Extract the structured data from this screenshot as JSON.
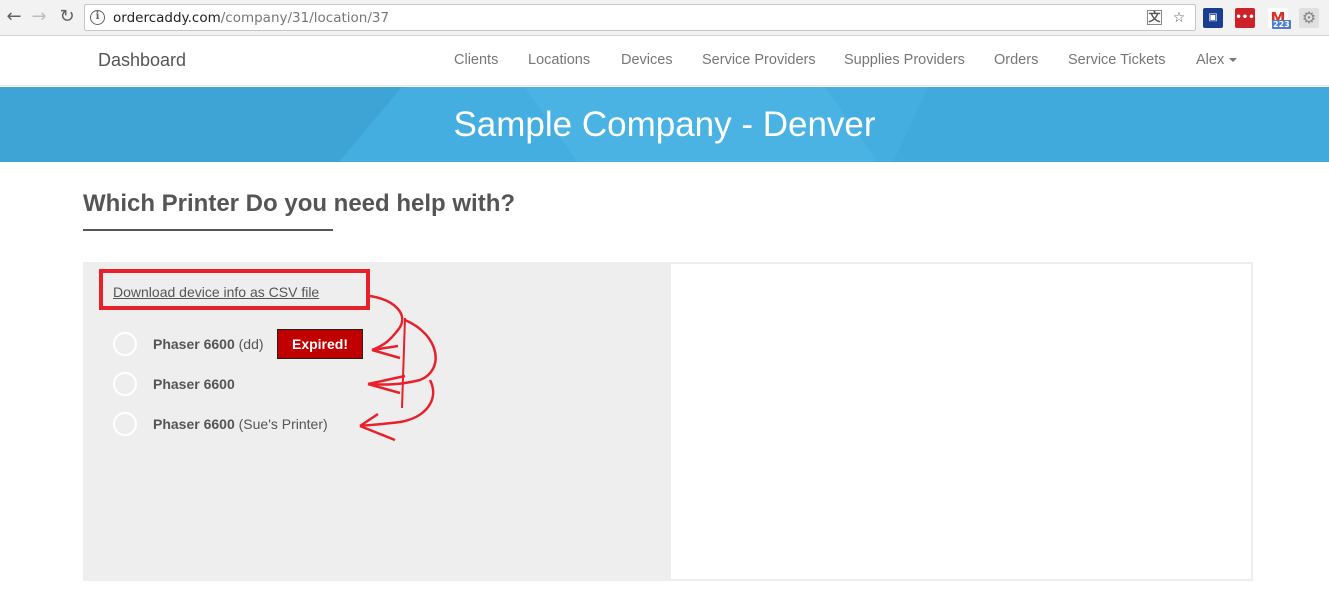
{
  "browser": {
    "url_host": "ordercaddy.com",
    "url_path": "/company/31/location/37",
    "extensions": [
      {
        "name": "translate-icon"
      },
      {
        "name": "bookmark-star-icon"
      },
      {
        "name": "extension-icon-1",
        "color": "#1a3d8f"
      },
      {
        "name": "lastpass-icon",
        "color": "#cc2229",
        "label": "•••"
      },
      {
        "name": "gmail-icon",
        "color": "#ffffff",
        "badge": "223"
      },
      {
        "name": "settings-gear-icon",
        "color": "#9e9e9e"
      }
    ]
  },
  "navbar": {
    "brand": "Dashboard",
    "links": [
      "Clients",
      "Locations",
      "Devices",
      "Service Providers",
      "Supplies Providers",
      "Orders",
      "Service Tickets"
    ],
    "user": "Alex"
  },
  "hero": {
    "title": "Sample Company - Denver",
    "bg_color": "#45aee0"
  },
  "page": {
    "heading": "Which Printer Do you need help with?",
    "csv_link": "Download device info as CSV file",
    "printers": [
      {
        "name": "Phaser 6600",
        "nickname": "(dd)",
        "badge": "Expired!"
      },
      {
        "name": "Phaser 6600",
        "nickname": ""
      },
      {
        "name": "Phaser 6600",
        "nickname": "(Sue's Printer)"
      }
    ]
  },
  "colors": {
    "expired_badge": "#c00000",
    "annotation": "#e8202a"
  }
}
